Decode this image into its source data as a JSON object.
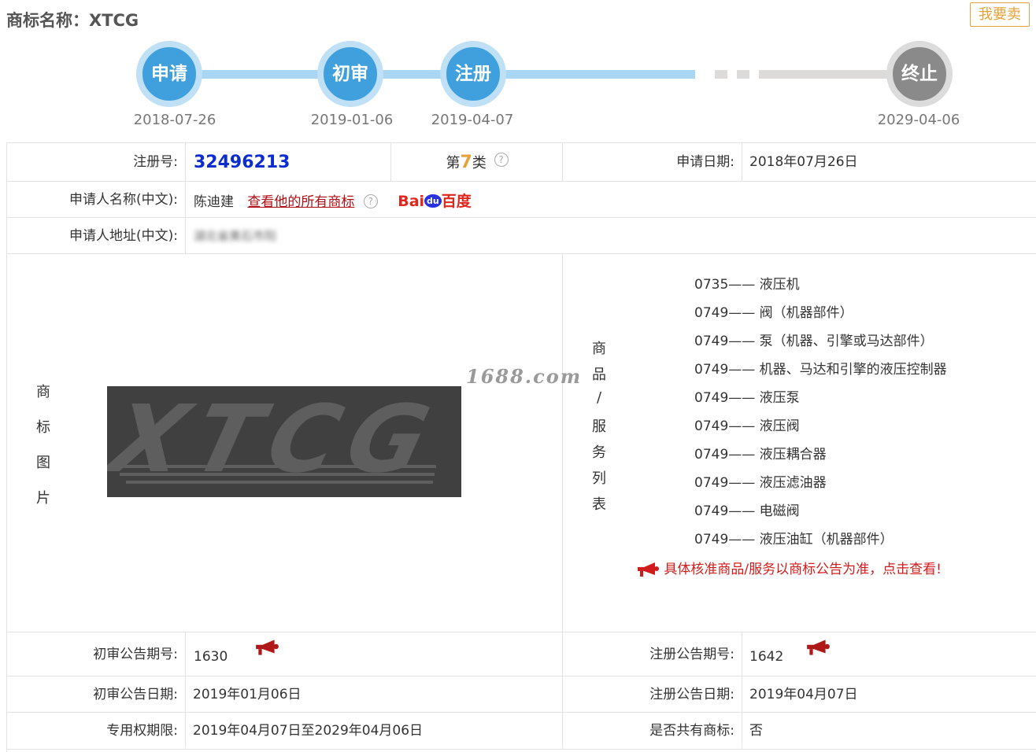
{
  "header": {
    "title": "商标名称：XTCG",
    "sell_button": "我要卖"
  },
  "timeline": {
    "steps": [
      {
        "label": "申请",
        "date": "2018-07-26",
        "status": "done"
      },
      {
        "label": "初审",
        "date": "2019-01-06",
        "status": "done"
      },
      {
        "label": "注册",
        "date": "2019-04-07",
        "status": "done"
      },
      {
        "label": "终止",
        "date": "2029-04-06",
        "status": "future"
      }
    ]
  },
  "colors": {
    "accent_blue": "#3fa0dd",
    "track_blue": "#a9d6f2",
    "gray": "#8a8a8a",
    "alert_red": "#d21c1c",
    "reg_blue": "#0b2dd0",
    "sell_orange": "#e5a23a"
  },
  "details": {
    "reg_no_label": "注册号:",
    "reg_no": "32496213",
    "class_prefix": "第",
    "class_num": "7",
    "class_suffix": "类",
    "apply_date_label": "申请日期:",
    "apply_date": "2018年07月26日",
    "applicant_label": "申请人名称(中文):",
    "applicant": "陈迪建",
    "view_all_link": "查看他的所有商标",
    "baidu_bai": "Bai",
    "baidu_du": "du",
    "baidu_cn": "百度",
    "address_label": "申请人地址(中文):",
    "address": "湖北省黄石市阳"
  },
  "image_section": {
    "label_chars": [
      "商",
      "标",
      "图",
      "片"
    ],
    "logo_text": "XTCG",
    "watermark": "1688.com"
  },
  "goods_section": {
    "label_chars": [
      "商",
      "品",
      "/",
      "服",
      "务",
      "列",
      "表"
    ],
    "items": [
      {
        "code": "0735",
        "name": "液压机"
      },
      {
        "code": "0749",
        "name": "阀（机器部件）"
      },
      {
        "code": "0749",
        "name": "泵（机器、引擎或马达部件）"
      },
      {
        "code": "0749",
        "name": "机器、马达和引擎的液压控制器"
      },
      {
        "code": "0749",
        "name": "液压泵"
      },
      {
        "code": "0749",
        "name": "液压阀"
      },
      {
        "code": "0749",
        "name": "液压耦合器"
      },
      {
        "code": "0749",
        "name": "液压滤油器"
      },
      {
        "code": "0749",
        "name": "电磁阀"
      },
      {
        "code": "0749",
        "name": "液压油缸（机器部件）"
      }
    ],
    "dash": "——",
    "notice": "具体核准商品/服务以商标公告为准，点击查看!"
  },
  "announcements": {
    "prelim_no_label": "初审公告期号:",
    "prelim_no": "1630",
    "reg_ann_no_label": "注册公告期号:",
    "reg_ann_no": "1642",
    "prelim_date_label": "初审公告日期:",
    "prelim_date": "2019年01月06日",
    "reg_ann_date_label": "注册公告日期:",
    "reg_ann_date": "2019年04月07日",
    "exclusive_label": "专用权期限:",
    "exclusive_period": "2019年04月07日至2029年04月06日",
    "shared_label": "是否共有商标:",
    "shared": "否"
  }
}
